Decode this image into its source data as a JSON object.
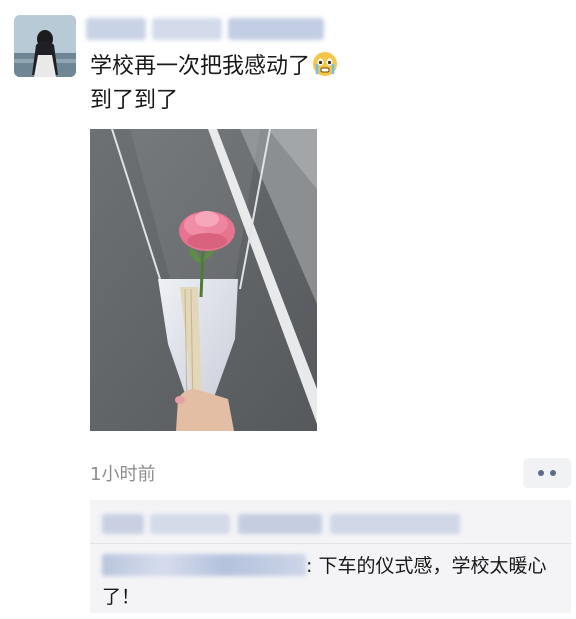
{
  "post": {
    "text_line1": "学校再一次把我感动了",
    "text_line2": "到了到了",
    "emoji": "crying-face",
    "time": "1小时前"
  },
  "comments": [
    {
      "separator": ":",
      "text": " 下车的仪式感，学校太暖心了！"
    }
  ],
  "colors": {
    "link_blue": "#576b95",
    "comment_bg": "#f4f4f6",
    "time_gray": "#8e8e8e"
  }
}
